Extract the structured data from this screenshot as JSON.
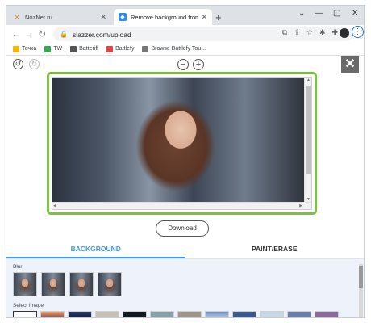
{
  "browser": {
    "tabs": [
      {
        "title": "NozNet.ru",
        "favicon": "tools-icon"
      },
      {
        "title": "Remove background from imag",
        "favicon": "slazzer-icon"
      }
    ],
    "new_tab": "+",
    "url": "slazzer.com/upload",
    "bookmarks": [
      {
        "label": "Точка",
        "color": "#f4b400"
      },
      {
        "label": "TW",
        "color": "#34a853"
      },
      {
        "label": "Batteriff",
        "color": "#555555"
      },
      {
        "label": "Battlefy",
        "color": "#e04545"
      },
      {
        "label": "Browse Battlefy Tou...",
        "color": "#777777"
      }
    ]
  },
  "editor": {
    "download_label": "Download",
    "tabs": [
      "BACKGROUND",
      "PAINT/ERASE"
    ],
    "blur_label": "Blur",
    "select_image_label": "Select Image",
    "accent": "#3d9be9",
    "frame_color": "#7cc241"
  }
}
